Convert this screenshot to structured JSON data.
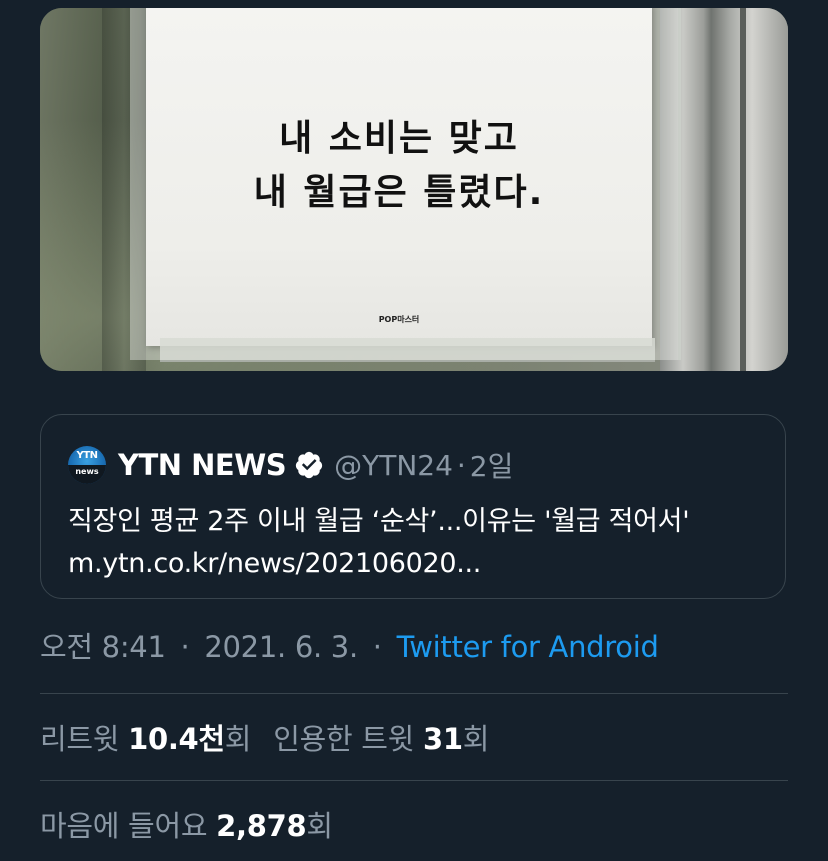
{
  "tweet_image": {
    "sign_line1": "내 소비는 맞고",
    "sign_line2": "내 월급은 틀렸다.",
    "sign_credit": "POP마스터"
  },
  "quoted_tweet": {
    "avatar_text_top": "YTN",
    "avatar_text_bottom": "news",
    "name": "YTN NEWS",
    "handle": "@YTN24",
    "separator": "·",
    "time": "2일",
    "text": "직장인 평균 2주 이내 월급 ‘순삭’...이유는 '월급 적어서'",
    "link": "m.ytn.co.kr/news/202106020..."
  },
  "meta": {
    "time": "오전 8:41",
    "separator": "·",
    "date": "2021. 6. 3.",
    "source": "Twitter for Android"
  },
  "stats": {
    "retweets_label": "리트윗",
    "retweets_count": "10.4천",
    "retweets_unit": "회",
    "quotes_label": "인용한 트윗",
    "quotes_count": "31",
    "quotes_unit": "회",
    "likes_label": "마음에 들어요",
    "likes_count": "2,878",
    "likes_unit": "회"
  },
  "colors": {
    "background": "#15202b",
    "border": "#38444d",
    "secondary_text": "#8b98a5",
    "link": "#1d9bf0",
    "verified": "#ffffff"
  }
}
